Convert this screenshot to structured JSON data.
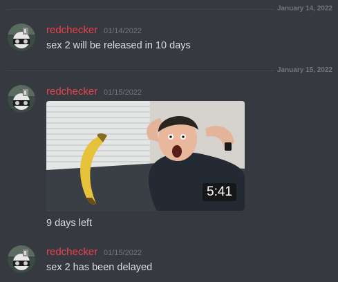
{
  "dividers": [
    {
      "label": "January 14, 2022"
    },
    {
      "label": "January 15, 2022"
    }
  ],
  "messages": [
    {
      "username": "redchecker",
      "timestamp": "01/14/2022",
      "text": "sex 2 will be released in 10 days"
    },
    {
      "username": "redchecker",
      "timestamp": "01/15/2022",
      "video_duration": "5:41",
      "text": "9 days left"
    },
    {
      "username": "redchecker",
      "timestamp": "01/15/2022",
      "text": "sex 2 has been delayed"
    }
  ],
  "colors": {
    "background": "#36393f",
    "username": "#e9434b",
    "text": "#dcddde",
    "muted": "#72767d",
    "divider": "#42454a"
  }
}
